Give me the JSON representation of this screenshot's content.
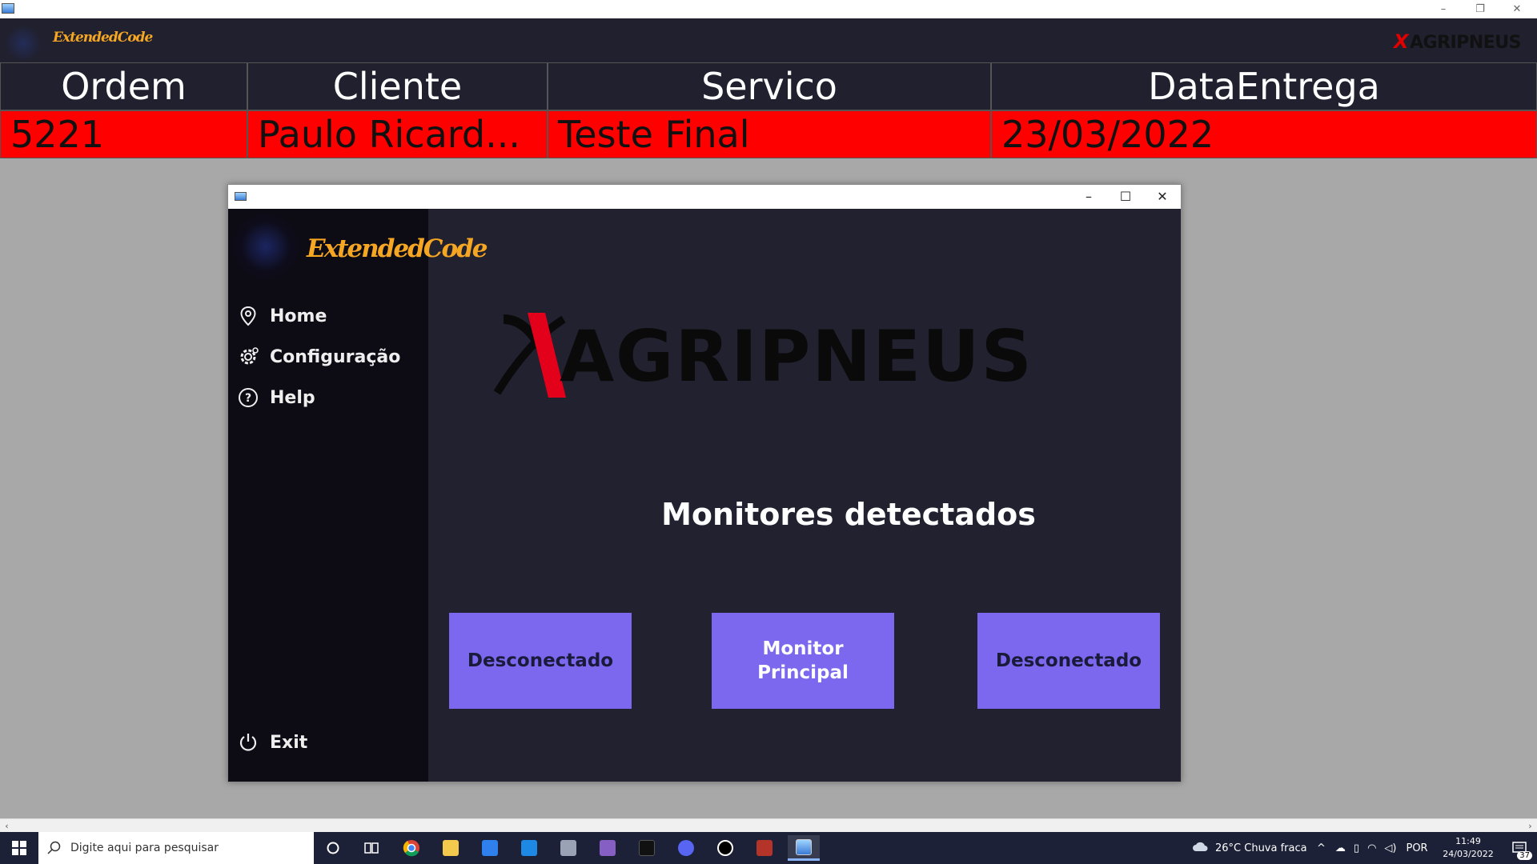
{
  "outer_window": {
    "controls": {
      "minimize": "–",
      "restore": "❐",
      "close": "✕"
    }
  },
  "header": {
    "brand": "ExtendedCode",
    "logo": {
      "mark": "X",
      "text": "AGRIPNEUS"
    }
  },
  "table": {
    "columns": [
      "Ordem",
      "Cliente",
      "Servico",
      "DataEntrega"
    ],
    "rows": [
      [
        "5221",
        "Paulo Ricard...",
        "Teste Final",
        "23/03/2022"
      ]
    ],
    "row_color": "#ff0000",
    "header_color": "#20202e"
  },
  "app_window": {
    "controls": {
      "minimize": "–",
      "maximize": "☐",
      "close": "✕"
    },
    "sidebar": {
      "brand": "ExtendedCode",
      "items": [
        {
          "label": "Home",
          "icon": "map-pin-icon"
        },
        {
          "label": "Configuração",
          "icon": "gear-icon"
        },
        {
          "label": "Help",
          "icon": "help-circle-icon"
        }
      ],
      "exit": {
        "label": "Exit",
        "icon": "power-icon"
      }
    },
    "main": {
      "logo_text": "AGRIPNEUS",
      "section_title": "Monitores detectados",
      "monitors": [
        {
          "label": "Desconectado"
        },
        {
          "label": "Monitor\nPrincipal"
        },
        {
          "label": "Desconectado"
        }
      ],
      "button_color": "#7b68ee"
    }
  },
  "taskbar": {
    "search_placeholder": "Digite aqui para pesquisar",
    "weather": "26°C  Chuva fraca",
    "language": "POR",
    "time": "11:49",
    "date": "24/03/2022",
    "notifications": "37"
  }
}
